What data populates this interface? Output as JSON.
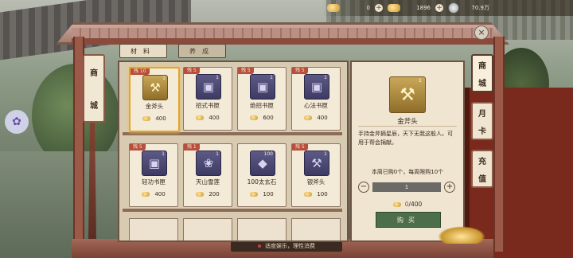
{
  "topbar": {
    "ingot_count": "0",
    "gold_count": "1896",
    "silver_count": "70.9万"
  },
  "left_scroll": [
    "商",
    "城"
  ],
  "tabs": [
    {
      "label": "材料",
      "active": true
    },
    {
      "label": "养成",
      "active": false
    }
  ],
  "items": [
    {
      "level": "残 10",
      "name": "金斧头",
      "qty": "1",
      "price": "400",
      "glyph": "⚒",
      "selected": true
    },
    {
      "level": "残 5",
      "name": "招式书匣",
      "qty": "1",
      "price": "400",
      "glyph": "▣",
      "selected": false
    },
    {
      "level": "残 5",
      "name": "绝招书匣",
      "qty": "1",
      "price": "600",
      "glyph": "▣",
      "selected": false
    },
    {
      "level": "残 5",
      "name": "心法书匣",
      "qty": "1",
      "price": "400",
      "glyph": "▣",
      "selected": false
    },
    {
      "level": "残 5",
      "name": "轻功书匣",
      "qty": "1",
      "price": "400",
      "glyph": "▣",
      "selected": false
    },
    {
      "level": "残 1",
      "name": "天山雪莲",
      "qty": "1",
      "price": "200",
      "glyph": "❀",
      "selected": false
    },
    {
      "level": "",
      "name": "100太玄石",
      "qty": "100",
      "price": "100",
      "glyph": "◆",
      "selected": false
    },
    {
      "level": "残 5",
      "name": "银斧头",
      "qty": "1",
      "price": "100",
      "glyph": "⚒",
      "selected": false
    }
  ],
  "detail": {
    "name": "金斧头",
    "qty": "1",
    "description": "手持金斧摘星辰，天下无我这般人。可用于帮会捐献。",
    "limit_text": "本周已购0个，每周限购10个",
    "quantity": "1",
    "decrease": "−",
    "increase": "+",
    "owned": "0",
    "cost_total": "/400",
    "buy_label": "购买"
  },
  "right_tabs": [
    {
      "chars": [
        "商",
        "城"
      ],
      "active": true
    },
    {
      "chars": [
        "月",
        "卡"
      ],
      "active": false
    },
    {
      "chars": [
        "充",
        "值"
      ],
      "active": false
    }
  ],
  "footer": "适度娱乐，理性消费",
  "close": "×",
  "petal_glyph": "✿",
  "colors": {
    "buy_button": "#4c6e4b",
    "selected_border": "#e0a52a",
    "level_badge": "#b84f3d"
  }
}
